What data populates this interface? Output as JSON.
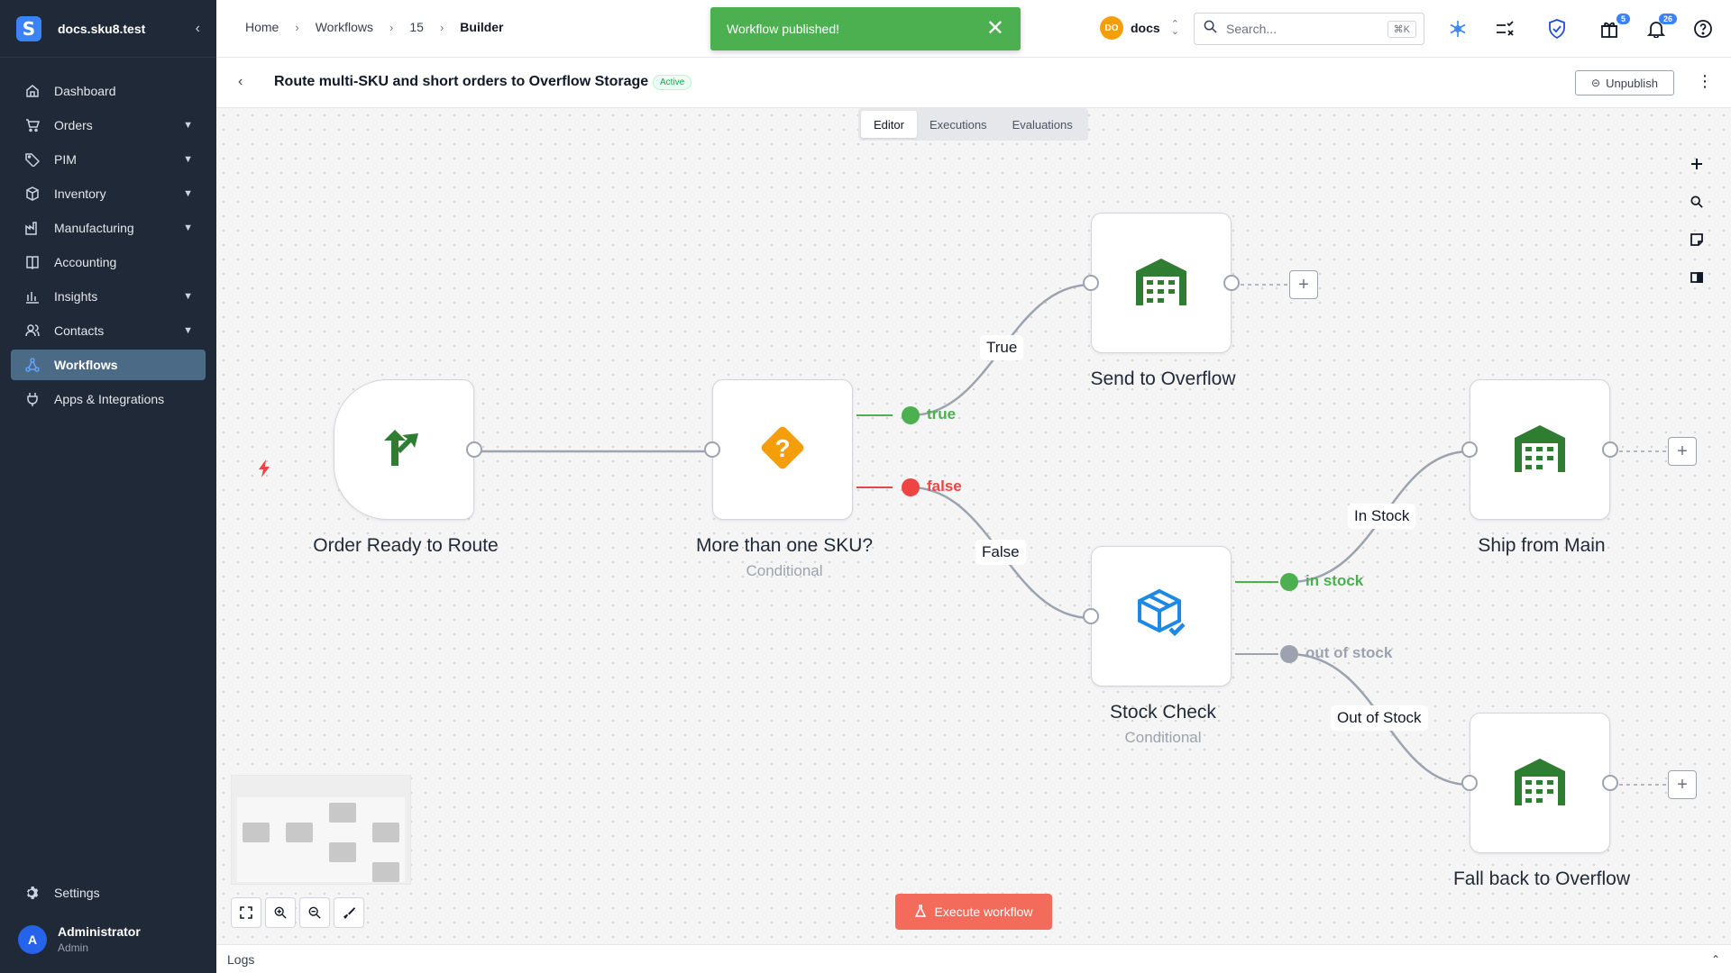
{
  "sidebar": {
    "workspace": "docs.sku8.test",
    "logo_letter": "S",
    "items": [
      {
        "label": "Dashboard"
      },
      {
        "label": "Orders"
      },
      {
        "label": "PIM"
      },
      {
        "label": "Inventory"
      },
      {
        "label": "Manufacturing"
      },
      {
        "label": "Accounting"
      },
      {
        "label": "Insights"
      },
      {
        "label": "Contacts"
      },
      {
        "label": "Workflows",
        "active": true
      },
      {
        "label": "Apps & Integrations"
      }
    ],
    "settings_label": "Settings",
    "user": {
      "initial": "A",
      "name": "Administrator",
      "role": "Admin"
    }
  },
  "topbar": {
    "breadcrumbs": [
      "Home",
      "Workflows",
      "15",
      "Builder"
    ],
    "org": {
      "initials": "DO",
      "name": "docs"
    },
    "search": {
      "placeholder": "Search...",
      "shortcut": "⌘K"
    },
    "badges": {
      "gifts": "5",
      "notifications": "26"
    }
  },
  "toast": {
    "message": "Workflow published!"
  },
  "workflow": {
    "title": "Route multi-SKU and short orders to Overflow Storage",
    "status": "Active",
    "unpublish_label": "Unpublish"
  },
  "tabs": [
    "Editor",
    "Executions",
    "Evaluations"
  ],
  "nodes": {
    "trigger": {
      "title": "Order Ready to Route"
    },
    "cond1": {
      "title": "More than one SKU?",
      "subtitle": "Conditional"
    },
    "overflow": {
      "title": "Send to Overflow"
    },
    "stock": {
      "title": "Stock Check",
      "subtitle": "Conditional"
    },
    "main": {
      "title": "Ship from Main"
    },
    "fallback": {
      "title": "Fall back to Overflow"
    }
  },
  "edges": {
    "true_label": "True",
    "false_label": "False",
    "in_stock_label": "In Stock",
    "out_of_stock_label": "Out of Stock"
  },
  "branches": {
    "true": "true",
    "false": "false",
    "in_stock": "in stock",
    "out_of_stock": "out of stock"
  },
  "execute_label": "Execute workflow",
  "logs_label": "Logs",
  "colors": {
    "green": "#4caf50",
    "red": "#ef4444",
    "grey": "#9ca3af",
    "accent": "#f26b5b",
    "node_icon_green": "#2e7d32",
    "node_icon_blue": "#1e88e5",
    "node_icon_orange": "#f59e0b"
  }
}
